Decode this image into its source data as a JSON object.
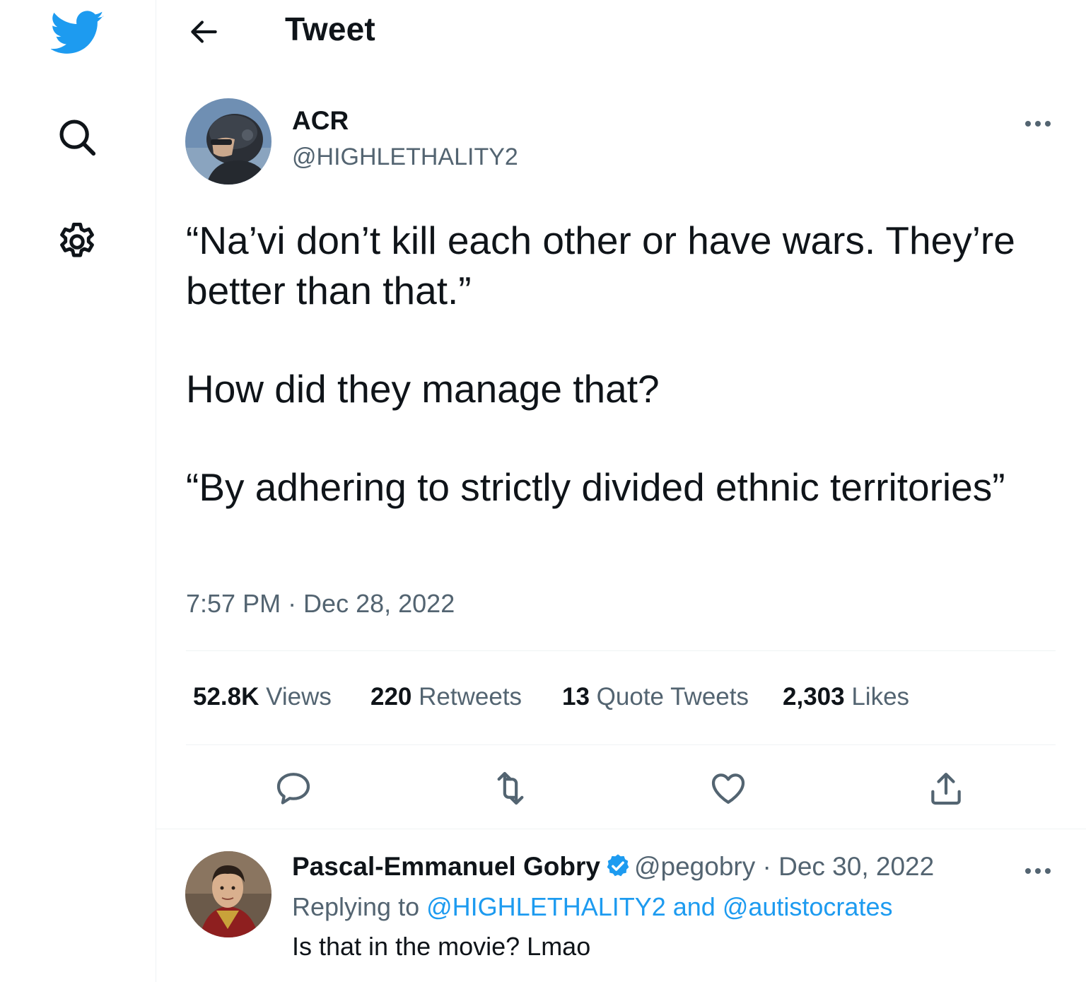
{
  "sidebar": {
    "logo_icon": "twitter-bird-icon",
    "search_icon": "search-icon",
    "settings_icon": "gear-icon",
    "brand_color": "#1d9bf0"
  },
  "header": {
    "back_icon": "arrow-left-icon",
    "title": "Tweet"
  },
  "tweet": {
    "display_name": "ACR",
    "handle": "@HIGHLETHALITY2",
    "text_paragraphs": [
      "“Na’vi don’t kill each other or have wars. They’re better than that.”",
      "How did they manage that?",
      "“By adhering to strictly divided ethnic territories”"
    ],
    "timestamp": "7:57 PM · Dec 28, 2022",
    "stats": {
      "views_count": "52.8K",
      "views_label": "Views",
      "retweets_count": "220",
      "retweets_label": "Retweets",
      "quotes_count": "13",
      "quotes_label": "Quote Tweets",
      "likes_count": "2,303",
      "likes_label": "Likes"
    },
    "actions": [
      "reply-icon",
      "retweet-icon",
      "like-icon",
      "share-icon"
    ]
  },
  "reply": {
    "display_name": "Pascal-Emmanuel Gobry",
    "verified_icon": "verified-badge-icon",
    "handle_date": "@pegobry · Dec 30, 2022",
    "replying_prefix": "Replying to",
    "replying_targets": "@HIGHLETHALITY2 and @autistocrates",
    "text": "Is that in the movie? Lmao"
  }
}
